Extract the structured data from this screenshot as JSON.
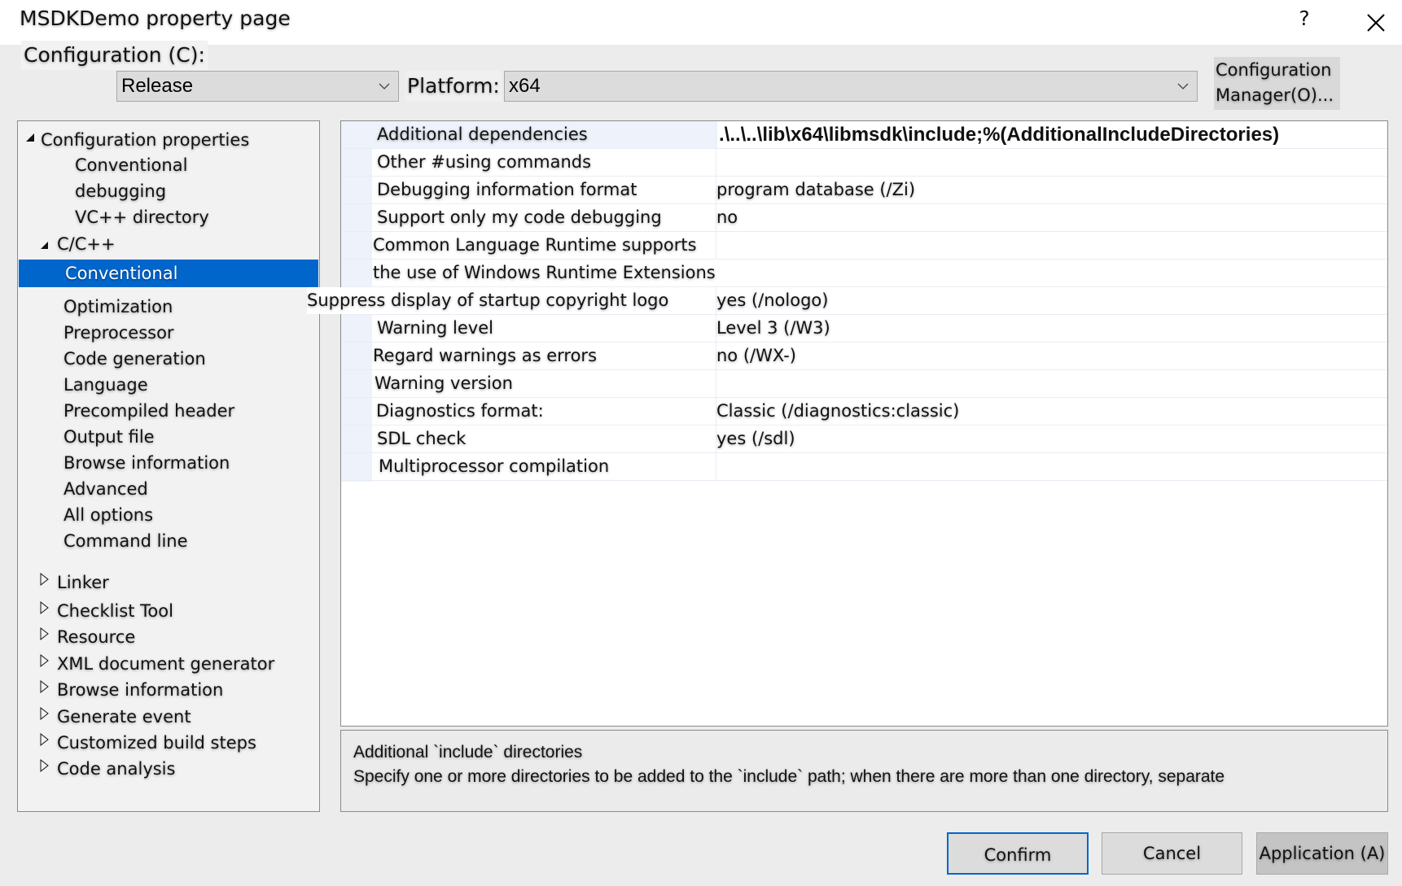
{
  "window": {
    "title": "MSDKDemo property page",
    "help_label": "?",
    "close_icon": "close-icon"
  },
  "config_bar": {
    "configuration_label": "Configuration (C):",
    "configuration_value": "Release",
    "platform_label": "Platform:",
    "platform_value": "x64",
    "config_manager_label_line1": "Configuration",
    "config_manager_label_line2": "Manager(O)..."
  },
  "tree": {
    "root": {
      "label": "Configuration properties",
      "expanded": true
    },
    "items": [
      {
        "label": "Conventional",
        "level": 1
      },
      {
        "label": "debugging",
        "level": 1
      },
      {
        "label": "VC++ directory",
        "level": 1
      },
      {
        "label": "C/C++",
        "level": 1,
        "expanded": true
      },
      {
        "label": "Conventional",
        "level": 2,
        "selected": true
      },
      {
        "label": "Optimization",
        "level": 2
      },
      {
        "label": "Preprocessor",
        "level": 2
      },
      {
        "label": "Code generation",
        "level": 2
      },
      {
        "label": "Language",
        "level": 2
      },
      {
        "label": "Precompiled header",
        "level": 2
      },
      {
        "label": "Output file",
        "level": 2
      },
      {
        "label": "Browse information",
        "level": 2
      },
      {
        "label": "Advanced",
        "level": 2
      },
      {
        "label": "All options",
        "level": 2
      },
      {
        "label": "Command line",
        "level": 2
      },
      {
        "label": "Linker",
        "level": 1,
        "expanded": false
      },
      {
        "label": "Checklist Tool",
        "level": 1,
        "expanded": false
      },
      {
        "label": "Resource",
        "level": 1,
        "expanded": false
      },
      {
        "label": "XML document generator",
        "level": 1,
        "expanded": false
      },
      {
        "label": "Browse information",
        "level": 1,
        "expanded": false
      },
      {
        "label": "Generate event",
        "level": 1,
        "expanded": false
      },
      {
        "label": "Customized build steps",
        "level": 1,
        "expanded": false
      },
      {
        "label": "Code analysis",
        "level": 1,
        "expanded": false
      }
    ]
  },
  "properties": [
    {
      "name": "Additional dependencies",
      "value": ".\\..\\..\\lib\\x64\\libmsdk\\include;%(AdditionalIncludeDirectories)"
    },
    {
      "name": "Other #using commands",
      "value": ""
    },
    {
      "name": "Debugging information format",
      "value": "program database (/Zi)"
    },
    {
      "name": "Support only my code debugging",
      "value": "no"
    },
    {
      "name": "Common Language Runtime supports",
      "value": ""
    },
    {
      "name": "the use of Windows Runtime Extensions",
      "value": ""
    },
    {
      "name": "Suppress display of startup copyright logo",
      "value": "yes (/nologo)"
    },
    {
      "name": "Warning level",
      "value": "Level 3 (/W3)"
    },
    {
      "name": "Regard warnings as errors",
      "value": "no (/WX-)"
    },
    {
      "name": "Warning version",
      "value": ""
    },
    {
      "name": "Diagnostics format:",
      "value": "Classic (/diagnostics:classic)"
    },
    {
      "name": "SDL check",
      "value": "yes (/sdl)"
    },
    {
      "name": "Multiprocessor compilation",
      "value": ""
    }
  ],
  "description": {
    "title": "Additional `include` directories",
    "body": "Specify one or more directories to be added to the `include` path; when there are more than one directory, separate"
  },
  "buttons": {
    "confirm": "Confirm",
    "cancel": "Cancel",
    "apply": "Application (A)"
  },
  "colors": {
    "selection": "#0066cc",
    "focus_border": "#0066cc",
    "grid_gutter": "#eef3fb"
  }
}
